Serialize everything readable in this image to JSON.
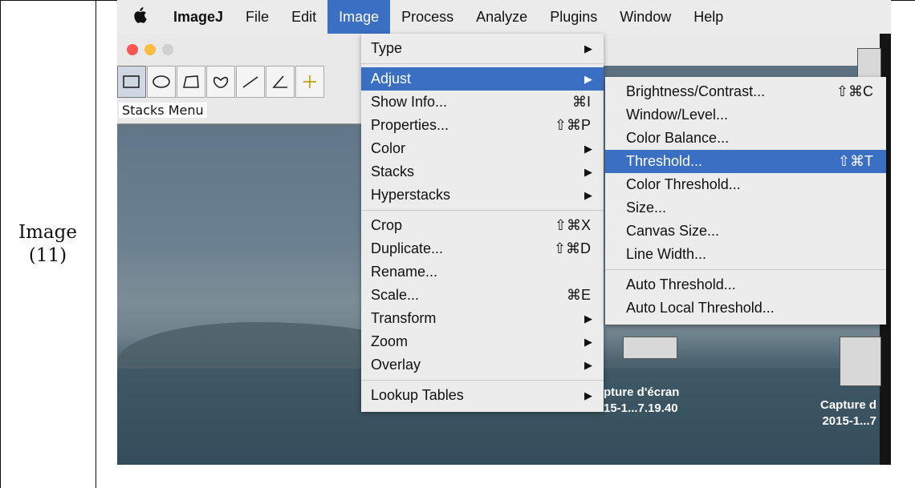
{
  "doc": {
    "label_line1": "Image",
    "label_line2": "(11)"
  },
  "menubar": {
    "apple": "",
    "items": [
      "ImageJ",
      "File",
      "Edit",
      "Image",
      "Process",
      "Analyze",
      "Plugins",
      "Window",
      "Help"
    ],
    "active": "Image"
  },
  "toolbar": {
    "stacks_label": "Stacks Menu"
  },
  "image_menu": {
    "items": [
      {
        "label": "Type",
        "shortcut": "",
        "submenu": true
      },
      {
        "label": "Adjust",
        "shortcut": "",
        "submenu": true,
        "highlighted": true
      },
      {
        "label": "Show Info...",
        "shortcut": "⌘I"
      },
      {
        "label": "Properties...",
        "shortcut": "⇧⌘P"
      },
      {
        "label": "Color",
        "shortcut": "",
        "submenu": true
      },
      {
        "label": "Stacks",
        "shortcut": "",
        "submenu": true
      },
      {
        "label": "Hyperstacks",
        "shortcut": "",
        "submenu": true
      },
      {
        "label": "Crop",
        "shortcut": "⇧⌘X"
      },
      {
        "label": "Duplicate...",
        "shortcut": "⇧⌘D"
      },
      {
        "label": "Rename...",
        "shortcut": ""
      },
      {
        "label": "Scale...",
        "shortcut": "⌘E"
      },
      {
        "label": "Transform",
        "shortcut": "",
        "submenu": true
      },
      {
        "label": "Zoom",
        "shortcut": "",
        "submenu": true
      },
      {
        "label": "Overlay",
        "shortcut": "",
        "submenu": true
      },
      {
        "label": "Lookup Tables",
        "shortcut": "",
        "submenu": true
      }
    ]
  },
  "adjust_menu": {
    "items": [
      {
        "label": "Brightness/Contrast...",
        "shortcut": "⇧⌘C"
      },
      {
        "label": "Window/Level...",
        "shortcut": ""
      },
      {
        "label": "Color Balance...",
        "shortcut": ""
      },
      {
        "label": "Threshold...",
        "shortcut": "⇧⌘T",
        "highlighted": true
      },
      {
        "label": "Color Threshold...",
        "shortcut": ""
      },
      {
        "label": "Size...",
        "shortcut": ""
      },
      {
        "label": "Canvas Size...",
        "shortcut": ""
      },
      {
        "label": "Line Width...",
        "shortcut": ""
      },
      {
        "label": "Auto Threshold...",
        "shortcut": ""
      },
      {
        "label": "Auto Local Threshold...",
        "shortcut": ""
      }
    ]
  },
  "desktop": {
    "captures": [
      {
        "line1": "pture d'écran",
        "line2": "15-1...7.19.40"
      },
      {
        "line1": "Capture d",
        "line2": "2015-1...7"
      }
    ]
  },
  "colors": {
    "highlight": "#3a6fc4",
    "menu_bg": "#ececec"
  }
}
